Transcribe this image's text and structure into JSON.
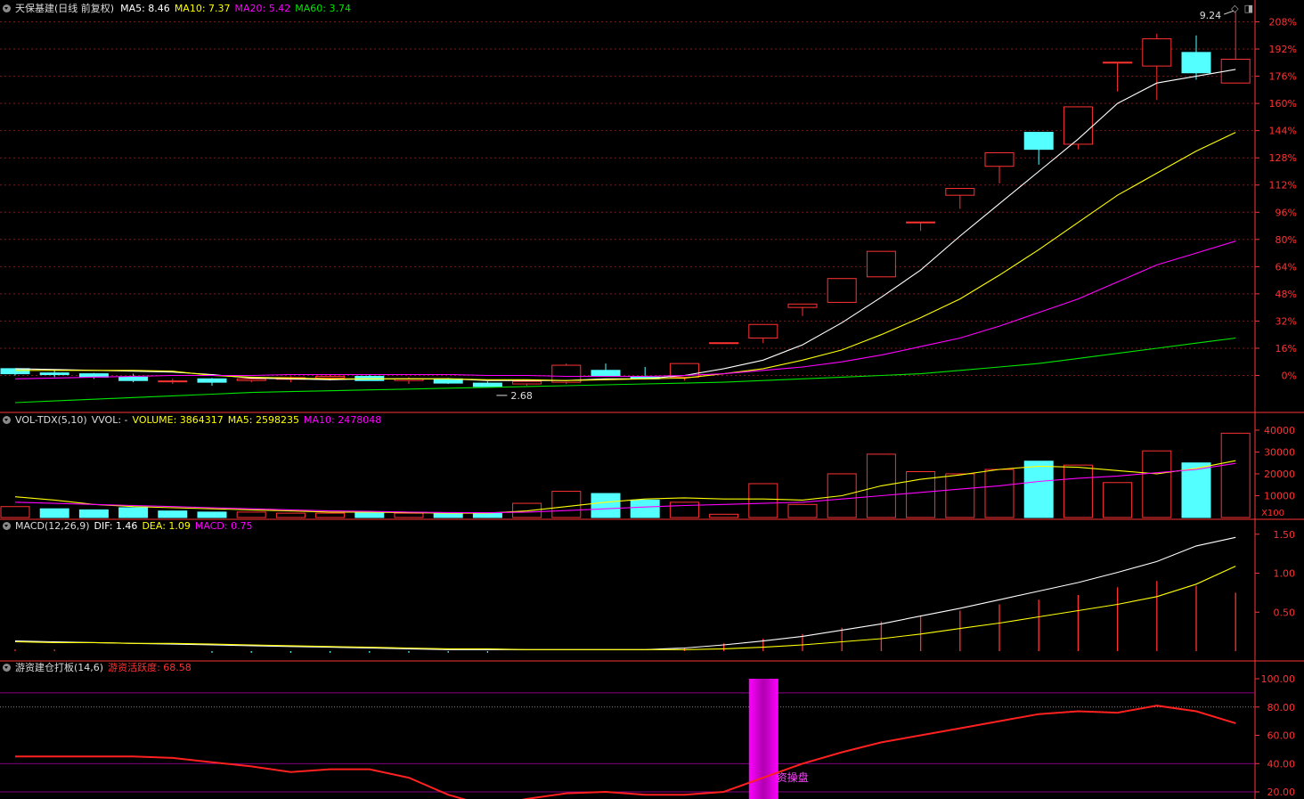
{
  "colors": {
    "up": "#ff3232",
    "down": "#54ffff",
    "ma5": "#ffffff",
    "ma10": "#ffff00",
    "ma20": "#ff00ff",
    "ma60": "#00e600",
    "axis": "#ff3232",
    "grid": "#801818"
  },
  "header": {
    "title": "天保基建(日线 前复权)",
    "ma5": "MA5: 8.46",
    "ma10": "MA10: 7.37",
    "ma20": "MA20: 5.42",
    "ma60": "MA60: 3.74",
    "icon_diamond": "◇",
    "icon_window": "◨"
  },
  "vol_header": {
    "name": "VOL-TDX(5,10)",
    "vvol": "VVOL: -",
    "volume": "VOLUME: 3864317",
    "ma5": "MA5: 2598235",
    "ma10": "MA10: 2478048"
  },
  "macd_header": {
    "name": "MACD(12,26,9)",
    "dif": "DIF: 1.46",
    "dea": "DEA: 1.09",
    "macd": "MACD: 0.75"
  },
  "ind_header": {
    "name": "游资建仓打板(14,6)",
    "activity": "游资活跃度: 68.58"
  },
  "annotations": {
    "high": "9.24",
    "low": "2.68",
    "operation": "资操盘",
    "vol_unit": "X100"
  },
  "chart_data": [
    {
      "type": "candlestick",
      "title": "天保基建(日线 前复权)",
      "y_axis": "percent",
      "ylim": [
        -4,
        212
      ],
      "yticks": [
        0,
        16,
        32,
        48,
        64,
        80,
        96,
        112,
        128,
        144,
        160,
        176,
        192,
        208
      ],
      "ytick_labels": [
        "0%",
        "16%",
        "32%",
        "48%",
        "64%",
        "80%",
        "96%",
        "112%",
        "128%",
        "144%",
        "160%",
        "176%",
        "192%",
        "208%"
      ],
      "ohlc_pct": [
        [
          4.0,
          4.0,
          0.0,
          1.0
        ],
        [
          1.5,
          3.5,
          -1.0,
          0.5
        ],
        [
          1.0,
          1.5,
          -2.0,
          -1.0
        ],
        [
          -1.0,
          1.0,
          -4.0,
          -3.0
        ],
        [
          -3.5,
          -2.0,
          -5.0,
          -3.5
        ],
        [
          -2.0,
          -1.5,
          -6.0,
          -4.0
        ],
        [
          -3.0,
          -1.0,
          -4.0,
          -2.0
        ],
        [
          -2.0,
          -0.5,
          -4.0,
          -1.5
        ],
        [
          -1.5,
          0.5,
          -3.0,
          -0.5
        ],
        [
          -0.5,
          0.5,
          -2.5,
          -3.0
        ],
        [
          -3.0,
          -1.0,
          -5.0,
          -2.0
        ],
        [
          -2.0,
          -1.5,
          -5.0,
          -4.5
        ],
        [
          -4.5,
          -3.5,
          -6.0,
          -6.5
        ],
        [
          -5.0,
          -3.0,
          -6.0,
          -3.5
        ],
        [
          -4.0,
          7.0,
          -5.0,
          6.0
        ],
        [
          3.0,
          7.0,
          0.0,
          0.0
        ],
        [
          -1.0,
          5.0,
          -2.0,
          -2.0
        ],
        [
          -1.0,
          7.0,
          -3.0,
          7.0
        ],
        [
          19.0,
          19.0,
          19.0,
          19.0
        ],
        [
          22.0,
          30.0,
          19.0,
          30.0
        ],
        [
          40.0,
          42.0,
          35.0,
          42.0
        ],
        [
          43.0,
          57.0,
          43.0,
          57.0
        ],
        [
          58.0,
          73.0,
          58.0,
          73.0
        ],
        [
          90.0,
          90.0,
          85.0,
          90.0
        ],
        [
          106.0,
          110.0,
          98.0,
          110.0
        ],
        [
          123.0,
          131.0,
          113.0,
          131.0
        ],
        [
          143.0,
          143.0,
          124.0,
          133.0
        ],
        [
          136.0,
          158.0,
          133.0,
          158.0
        ],
        [
          184.0,
          184.0,
          167.0,
          184.0
        ],
        [
          182.0,
          201.0,
          162.0,
          198.0
        ],
        [
          190.0,
          200.0,
          174.0,
          178.0
        ],
        [
          172.0,
          214.0,
          172.0,
          186.0
        ]
      ],
      "series": [
        {
          "name": "MA5: 8.46",
          "values": [
            4,
            3.5,
            3,
            2.5,
            2,
            0.5,
            -1.5,
            -2,
            -2.5,
            -2,
            -2,
            -2,
            -3,
            -3,
            -3,
            -2,
            -2,
            0,
            4,
            9,
            18,
            31,
            46,
            62,
            82,
            101,
            120,
            139,
            160,
            172,
            176,
            180
          ]
        },
        {
          "name": "MA10: 7.37",
          "values": [
            3,
            3,
            3,
            3,
            2.5,
            0,
            -1,
            -1.5,
            -2,
            -2,
            -2,
            -2,
            -2.5,
            -2.5,
            -3,
            -2.5,
            -2,
            -1.5,
            1,
            4,
            9,
            15,
            24,
            34,
            45,
            59,
            74,
            90,
            106,
            119,
            132,
            143
          ]
        },
        {
          "name": "MA20: 5.42",
          "values": [
            -2.0,
            -1.5,
            -1.0,
            -0.5,
            0.0,
            0.0,
            0.0,
            0.5,
            0.5,
            0.5,
            0.5,
            0.5,
            0.0,
            0.0,
            -0.5,
            -0.5,
            -0.5,
            0.0,
            1.0,
            3.0,
            5.0,
            8.0,
            12.0,
            17.0,
            22.0,
            29.0,
            37.0,
            45.0,
            55.0,
            65.0,
            72.0,
            79.0
          ]
        },
        {
          "name": "MA60: 3.74",
          "values": [
            -16.0,
            -15.0,
            -14.0,
            -13.0,
            -12.0,
            -11.0,
            -10.0,
            -9.5,
            -9.0,
            -8.5,
            -8.0,
            -7.5,
            -7.0,
            -6.5,
            -6.0,
            -5.5,
            -5.0,
            -4.5,
            -4.0,
            -3.0,
            -2.0,
            -1.0,
            0.0,
            1.0,
            3.0,
            5.0,
            7.0,
            10.0,
            13.0,
            16.0,
            19.0,
            22.0
          ]
        }
      ],
      "annotations": [
        {
          "text": "9.24",
          "index": 31,
          "value_pct": 214
        },
        {
          "text": "2.68",
          "index": 12,
          "value_pct": -6.5
        }
      ]
    },
    {
      "type": "bar",
      "title": "VOL-TDX(5,10)",
      "ylim": [
        0,
        42000
      ],
      "yticks": [
        10000,
        20000,
        30000,
        40000
      ],
      "ytick_labels": [
        "10000",
        "20000",
        "30000",
        "40000"
      ],
      "unit": "X100",
      "values": [
        5000,
        4000,
        3500,
        4500,
        3000,
        2500,
        2500,
        2000,
        2000,
        2500,
        2000,
        2000,
        2000,
        6500,
        12000,
        11000,
        8000,
        7000,
        1500,
        15500,
        6000,
        20000,
        29000,
        21000,
        20000,
        22000,
        25800,
        24000,
        16000,
        30500,
        25000,
        38600
      ],
      "colors": [
        "up",
        "down",
        "down",
        "down",
        "down",
        "down",
        "up",
        "up",
        "up",
        "down",
        "up",
        "down",
        "down",
        "up",
        "up",
        "down",
        "down",
        "up",
        "up",
        "up",
        "up",
        "up",
        "up",
        "up",
        "up",
        "up",
        "down",
        "up",
        "up",
        "up",
        "down",
        "up"
      ],
      "series": [
        {
          "name": "MA5: 2598235",
          "values": [
            9500,
            8000,
            6000,
            5000,
            4500,
            4000,
            3500,
            3000,
            2500,
            2500,
            2200,
            2000,
            2000,
            3000,
            5000,
            7000,
            8500,
            9000,
            8500,
            8500,
            8000,
            10000,
            14500,
            17500,
            19500,
            22000,
            23500,
            23000,
            21500,
            20000,
            22500,
            26000
          ]
        },
        {
          "name": "MA10: 2478048",
          "values": [
            7000,
            6500,
            6000,
            5500,
            5000,
            4500,
            4000,
            3500,
            3000,
            2800,
            2500,
            2300,
            2200,
            2500,
            3200,
            4000,
            4800,
            5500,
            6000,
            6500,
            7000,
            8500,
            10000,
            11500,
            13000,
            14500,
            16500,
            18000,
            19000,
            20500,
            22000,
            24800
          ]
        }
      ]
    },
    {
      "type": "line",
      "title": "MACD(12,26,9)",
      "ylim": [
        0,
        1.6
      ],
      "yticks": [
        0.5,
        1.0,
        1.5
      ],
      "ytick_labels": [
        "0.50",
        "1.00",
        "1.50"
      ],
      "series": [
        {
          "name": "DIF: 1.46",
          "values": [
            0.13,
            0.12,
            0.11,
            0.1,
            0.09,
            0.08,
            0.07,
            0.06,
            0.05,
            0.04,
            0.03,
            0.02,
            0.02,
            0.02,
            0.02,
            0.02,
            0.02,
            0.04,
            0.08,
            0.13,
            0.19,
            0.27,
            0.35,
            0.45,
            0.55,
            0.66,
            0.77,
            0.88,
            1.01,
            1.15,
            1.35,
            1.46
          ]
        },
        {
          "name": "DEA: 1.09",
          "values": [
            0.12,
            0.11,
            0.11,
            0.1,
            0.1,
            0.09,
            0.08,
            0.07,
            0.06,
            0.05,
            0.04,
            0.03,
            0.03,
            0.02,
            0.02,
            0.02,
            0.02,
            0.02,
            0.03,
            0.05,
            0.08,
            0.12,
            0.16,
            0.22,
            0.29,
            0.36,
            0.44,
            0.52,
            0.6,
            0.7,
            0.86,
            1.09
          ]
        },
        {
          "name": "MACD: 0.75",
          "values": [
            0.02,
            0.02,
            0.0,
            0.0,
            0.0,
            -0.02,
            -0.02,
            -0.02,
            -0.02,
            -0.02,
            -0.02,
            -0.02,
            -0.02,
            0.0,
            0.0,
            0.0,
            0.0,
            0.04,
            0.1,
            0.16,
            0.22,
            0.3,
            0.38,
            0.46,
            0.52,
            0.6,
            0.66,
            0.72,
            0.82,
            0.9,
            0.84,
            0.75
          ]
        }
      ]
    },
    {
      "type": "line",
      "title": "游资建仓打板(14,6)",
      "ylim": [
        20,
        100
      ],
      "yticks": [
        20,
        40,
        60,
        80,
        100
      ],
      "ytick_labels": [
        "20.00",
        "40.00",
        "60.00",
        "80.00",
        "100.00"
      ],
      "reference_lines": [
        20,
        40,
        80,
        90
      ],
      "series": [
        {
          "name": "游资活跃度: 68.58",
          "values": [
            45,
            45,
            45,
            45,
            44,
            41,
            38,
            34,
            36,
            36,
            30,
            18,
            10,
            15,
            19,
            20,
            18,
            18,
            20,
            30,
            40,
            48,
            55,
            60,
            65,
            70,
            75,
            77,
            76,
            81,
            77,
            68.58
          ]
        }
      ],
      "bars": [
        {
          "index": 19,
          "from": 0,
          "to": 100
        }
      ]
    }
  ]
}
